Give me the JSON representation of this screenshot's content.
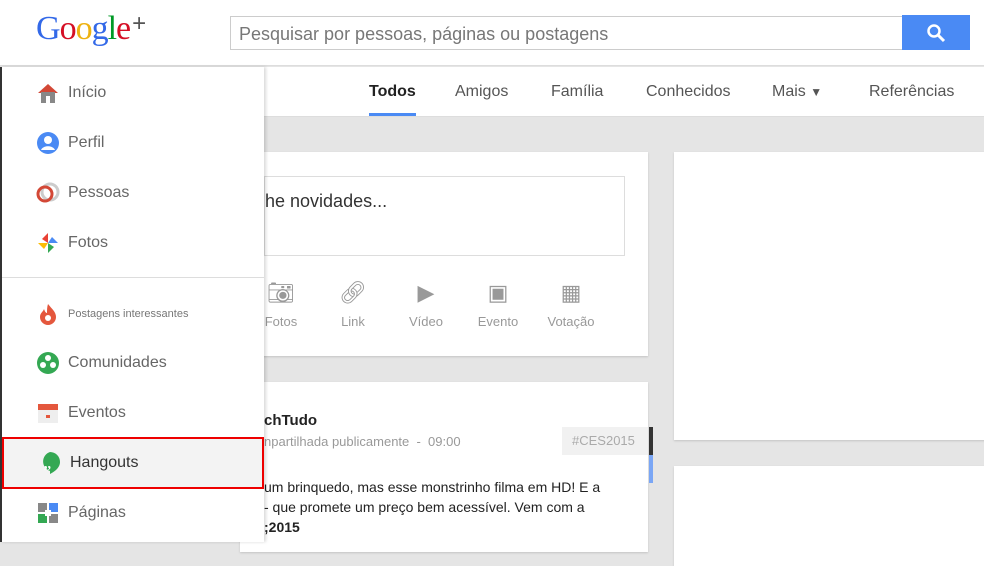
{
  "header": {
    "logo": "Google",
    "logo_plus": "+",
    "search_placeholder": "Pesquisar por pessoas, páginas ou postagens"
  },
  "tabs": [
    "Todos",
    "Amigos",
    "Família",
    "Conhecidos",
    "Mais",
    "Referências"
  ],
  "sidebar": {
    "items": [
      "Início",
      "Perfil",
      "Pessoas",
      "Fotos",
      "Postagens interessantes",
      "Comunidades",
      "Eventos",
      "Hangouts",
      "Páginas"
    ]
  },
  "compose": {
    "placeholder": "he novidades...",
    "actions": [
      "Fotos",
      "Link",
      "Vídeo",
      "Evento",
      "Votação"
    ]
  },
  "post": {
    "author": "chTudo",
    "meta": "npartilhada publicamente  -  09:00",
    "tag": "#CES2015",
    "lines": [
      "um brinquedo, mas esse monstrinho filma em HD! E a",
      "- que promete um preço bem acessível. Vem com a",
      ";2015"
    ]
  },
  "colors": {
    "accent": "#4a8af4",
    "highlight": "#e00000"
  }
}
